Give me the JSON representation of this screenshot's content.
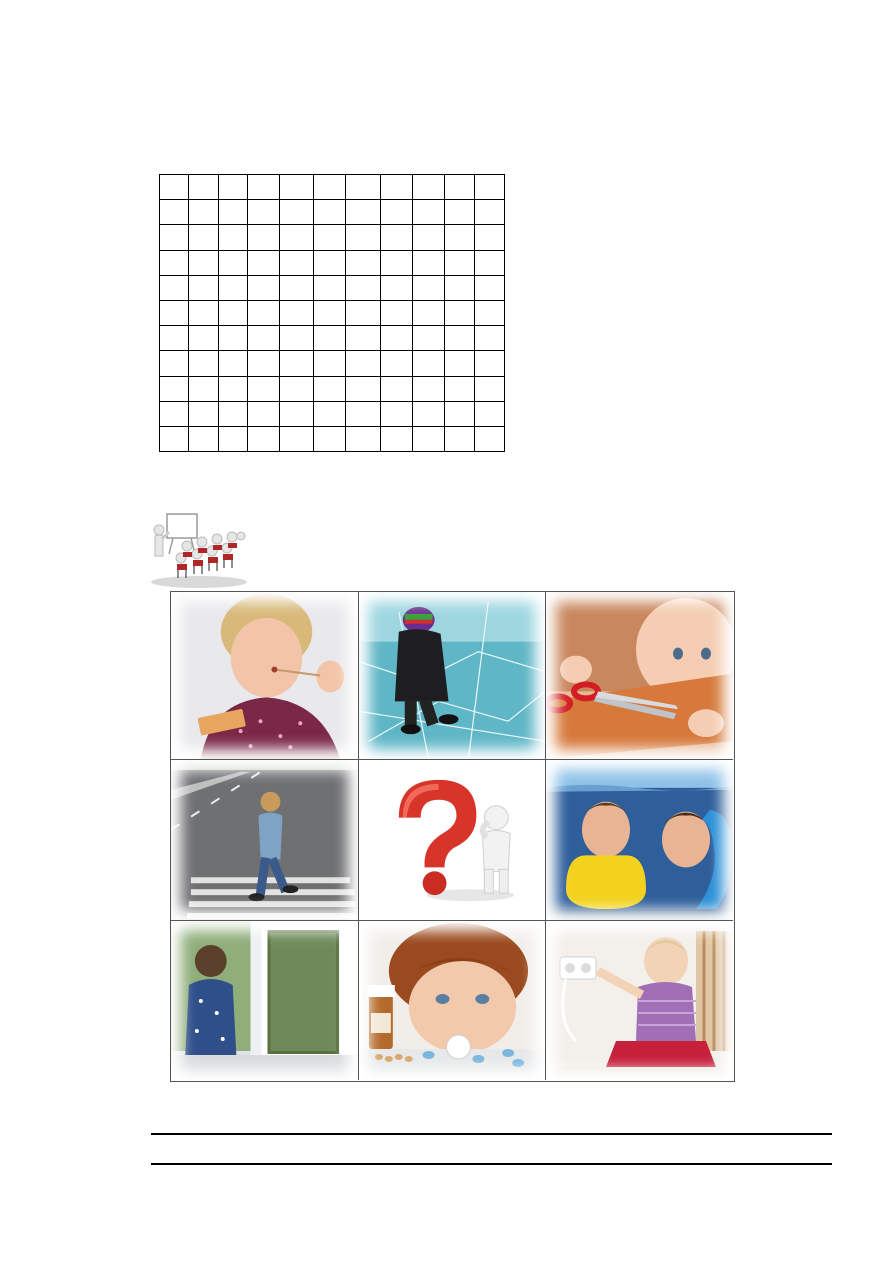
{
  "worksheet": {
    "grid": {
      "rows": 11,
      "cols": 11,
      "cells": [
        [
          "",
          "",
          "",
          "",
          "",
          "",
          "",
          "",
          "",
          "",
          ""
        ],
        [
          "",
          "",
          "",
          "",
          "",
          "",
          "",
          "",
          "",
          "",
          ""
        ],
        [
          "",
          "",
          "",
          "",
          "",
          "",
          "",
          "",
          "",
          "",
          ""
        ],
        [
          "",
          "",
          "",
          "",
          "",
          "",
          "",
          "",
          "",
          "",
          ""
        ],
        [
          "",
          "",
          "",
          "",
          "",
          "",
          "",
          "",
          "",
          "",
          ""
        ],
        [
          "",
          "",
          "",
          "",
          "",
          "",
          "",
          "",
          "",
          "",
          ""
        ],
        [
          "",
          "",
          "",
          "",
          "",
          "",
          "",
          "",
          "",
          "",
          ""
        ],
        [
          "",
          "",
          "",
          "",
          "",
          "",
          "",
          "",
          "",
          "",
          ""
        ],
        [
          "",
          "",
          "",
          "",
          "",
          "",
          "",
          "",
          "",
          "",
          ""
        ],
        [
          "",
          "",
          "",
          "",
          "",
          "",
          "",
          "",
          "",
          "",
          ""
        ],
        [
          "",
          "",
          "",
          "",
          "",
          "",
          "",
          "",
          "",
          "",
          ""
        ]
      ]
    },
    "clipart": {
      "icon": "presenter-with-audience-icon"
    },
    "collage": {
      "photos": [
        {
          "icon": "child-with-matches-photo"
        },
        {
          "icon": "child-on-thin-ice-photo"
        },
        {
          "icon": "baby-with-scissors-photo"
        },
        {
          "icon": "child-crossing-road-photo"
        },
        {
          "icon": "question-mark-figure-icon"
        },
        {
          "icon": "children-swimming-photo"
        },
        {
          "icon": "child-at-open-window-photo"
        },
        {
          "icon": "child-with-pills-photo"
        },
        {
          "icon": "baby-at-power-outlet-photo"
        }
      ]
    },
    "answer_lines": 2
  }
}
